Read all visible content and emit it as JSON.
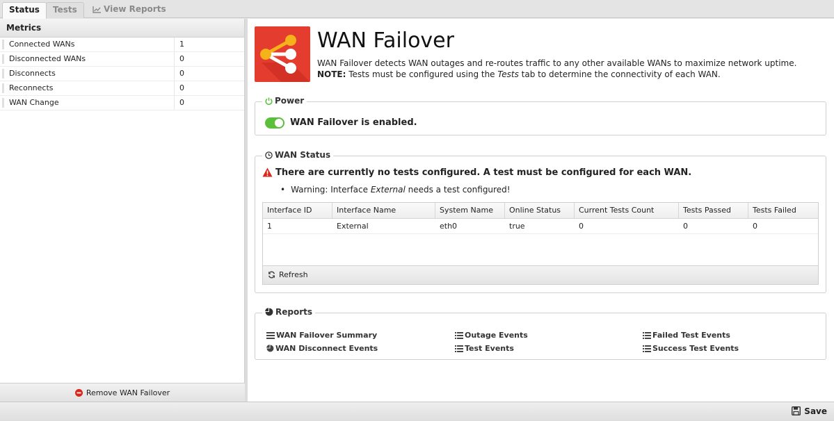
{
  "tabs": [
    {
      "label": "Status"
    },
    {
      "label": "Tests"
    },
    {
      "label": "View Reports"
    }
  ],
  "metrics": {
    "header": "Metrics",
    "rows": [
      {
        "name": "Connected WANs",
        "value": "1"
      },
      {
        "name": "Disconnected WANs",
        "value": "0"
      },
      {
        "name": "Disconnects",
        "value": "0"
      },
      {
        "name": "Reconnects",
        "value": "0"
      },
      {
        "name": "WAN Change",
        "value": "0"
      }
    ],
    "remove_label": "Remove WAN Failover"
  },
  "app": {
    "title": "WAN Failover",
    "description": "WAN Failover detects WAN outages and re-routes traffic to any other available WANs to maximize network uptime.",
    "note_label": "NOTE:",
    "note_pre": " Tests must be configured using the ",
    "note_tab": "Tests",
    "note_post": " tab to determine the connectivity of each WAN."
  },
  "power": {
    "legend": "Power",
    "status": "WAN Failover is enabled.",
    "enabled": true
  },
  "wan_status": {
    "legend": "WAN Status",
    "warning": "There are currently no tests configured. A test must be configured for each WAN.",
    "bullet_pre": "Warning: Interface ",
    "bullet_iface": "External",
    "bullet_post": " needs a test configured!",
    "columns": [
      "Interface ID",
      "Interface Name",
      "System Name",
      "Online Status",
      "Current Tests Count",
      "Tests Passed",
      "Tests Failed"
    ],
    "rows": [
      [
        "1",
        "External",
        "eth0",
        "true",
        "0",
        "0",
        "0"
      ]
    ],
    "refresh_label": "Refresh"
  },
  "reports": {
    "legend": "Reports",
    "items": [
      {
        "label": "WAN Failover Summary",
        "icon": "list-icon"
      },
      {
        "label": "WAN Disconnect Events",
        "icon": "pie-chart-icon"
      },
      {
        "label": "Outage Events",
        "icon": "list-icon"
      },
      {
        "label": "Test Events",
        "icon": "list-icon"
      },
      {
        "label": "Failed Test Events",
        "icon": "list-icon"
      },
      {
        "label": "Success Test Events",
        "icon": "list-icon"
      }
    ]
  },
  "footer": {
    "save_label": "Save"
  },
  "colors": {
    "accent_green": "#5bbf3a",
    "app_icon_red": "#e43d30",
    "warning_red": "#d9261c"
  }
}
